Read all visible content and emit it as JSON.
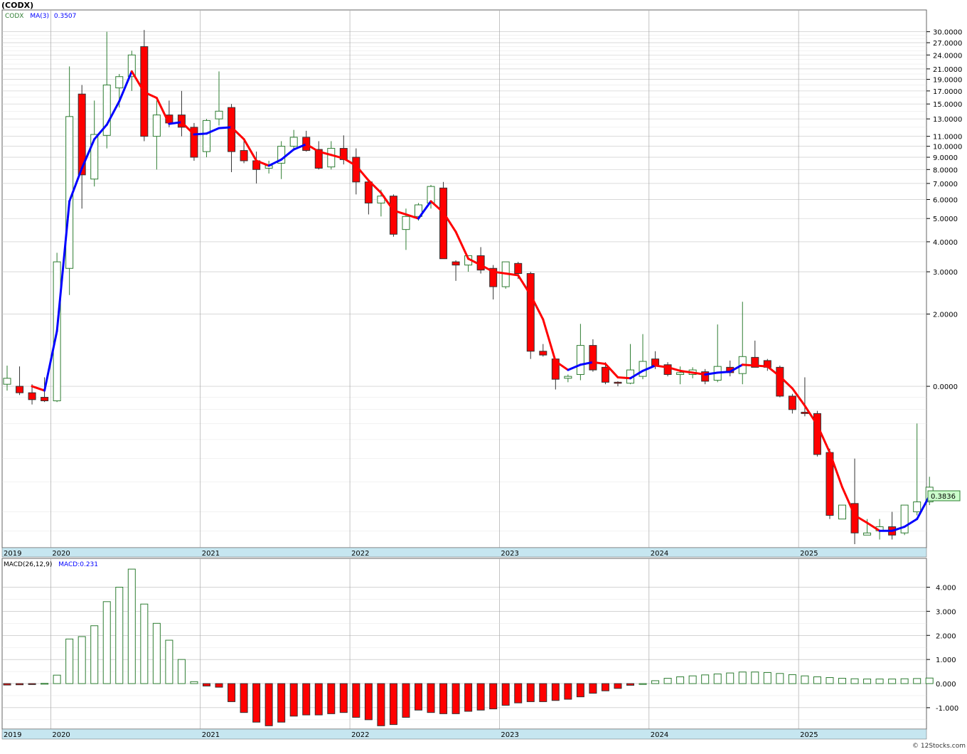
{
  "window_title": "(CODX)",
  "watermark": "© 12Stocks.com",
  "colors": {
    "up_outline": "#2e7d32",
    "down_fill": "#ff0000",
    "ma_up": "#0000ff",
    "ma_down": "#ff0000",
    "axis_band": "#c6e6f0",
    "grid": "#aaaaaa",
    "last_price_box": "#ccffcc"
  },
  "chart_data": [
    {
      "type": "candlestick",
      "id": "price",
      "legend": {
        "symbol": "CODX",
        "ma_label": "MA(3)",
        "ma_value": "0.3507"
      },
      "y_scale": "log",
      "ylim": [
        0.22,
        35
      ],
      "y_tick_labels": [
        "30.0000",
        "27.0000",
        "24.0000",
        "21.0000",
        "19.0000",
        "17.0000",
        "15.0000",
        "13.0000",
        "11.0000",
        "10.0000",
        "9.0000",
        "8.0000",
        "7.0000",
        "6.0000",
        "5.0000",
        "4.0000",
        "3.0000",
        "2.0000",
        "0.0000"
      ],
      "y_tick_values": [
        30,
        27,
        24,
        21,
        19,
        17,
        15,
        13,
        11,
        10,
        9,
        8,
        7,
        6,
        5,
        4,
        3,
        2,
        1
      ],
      "year_labels": [
        "2019",
        "2020",
        "2021",
        "2022",
        "2023",
        "2024",
        "2025"
      ],
      "year_start_index": [
        0,
        4,
        16,
        28,
        40,
        52,
        64
      ],
      "last_price_label": "0.3836",
      "candles": [
        {
          "o": 1.02,
          "h": 1.22,
          "l": 0.96,
          "c": 1.08
        },
        {
          "o": 1.0,
          "h": 1.21,
          "l": 0.92,
          "c": 0.94
        },
        {
          "o": 0.94,
          "h": 1.02,
          "l": 0.84,
          "c": 0.88
        },
        {
          "o": 0.9,
          "h": 1.09,
          "l": 0.86,
          "c": 0.87
        },
        {
          "o": 0.87,
          "h": 3.6,
          "l": 0.86,
          "c": 3.3
        },
        {
          "o": 3.1,
          "h": 21.5,
          "l": 2.4,
          "c": 13.3
        },
        {
          "o": 16.5,
          "h": 18.0,
          "l": 5.5,
          "c": 7.6
        },
        {
          "o": 7.3,
          "h": 15.5,
          "l": 6.8,
          "c": 11.2
        },
        {
          "o": 11.1,
          "h": 30.0,
          "l": 9.8,
          "c": 18.0
        },
        {
          "o": 17.5,
          "h": 20.0,
          "l": 14.5,
          "c": 19.5
        },
        {
          "o": 19.5,
          "h": 25.0,
          "l": 17.0,
          "c": 24.0
        },
        {
          "o": 26.0,
          "h": 30.5,
          "l": 10.5,
          "c": 11.0
        },
        {
          "o": 11.0,
          "h": 15.5,
          "l": 8.0,
          "c": 13.5
        },
        {
          "o": 13.5,
          "h": 15.5,
          "l": 12.0,
          "c": 12.5
        },
        {
          "o": 13.5,
          "h": 17.0,
          "l": 11.0,
          "c": 12.0
        },
        {
          "o": 12.0,
          "h": 12.5,
          "l": 8.7,
          "c": 9.0
        },
        {
          "o": 9.5,
          "h": 13.0,
          "l": 9.0,
          "c": 12.8
        },
        {
          "o": 13.0,
          "h": 20.5,
          "l": 12.2,
          "c": 14.0
        },
        {
          "o": 14.5,
          "h": 15.0,
          "l": 7.8,
          "c": 9.5
        },
        {
          "o": 9.6,
          "h": 10.5,
          "l": 8.5,
          "c": 8.7
        },
        {
          "o": 8.7,
          "h": 9.5,
          "l": 7.0,
          "c": 8.0
        },
        {
          "o": 8.1,
          "h": 8.7,
          "l": 7.7,
          "c": 8.3
        },
        {
          "o": 8.5,
          "h": 10.5,
          "l": 7.3,
          "c": 10.0
        },
        {
          "o": 10.0,
          "h": 11.7,
          "l": 9.7,
          "c": 10.9
        },
        {
          "o": 10.9,
          "h": 11.6,
          "l": 9.5,
          "c": 9.6
        },
        {
          "o": 9.7,
          "h": 10.5,
          "l": 8.0,
          "c": 8.1
        },
        {
          "o": 8.2,
          "h": 10.5,
          "l": 8.0,
          "c": 9.8
        },
        {
          "o": 9.8,
          "h": 11.1,
          "l": 8.4,
          "c": 8.8
        },
        {
          "o": 9.0,
          "h": 9.8,
          "l": 6.3,
          "c": 7.1
        },
        {
          "o": 7.1,
          "h": 7.2,
          "l": 5.2,
          "c": 5.8
        },
        {
          "o": 5.8,
          "h": 6.6,
          "l": 5.1,
          "c": 6.2
        },
        {
          "o": 6.2,
          "h": 6.3,
          "l": 4.2,
          "c": 4.3
        },
        {
          "o": 4.5,
          "h": 5.5,
          "l": 3.7,
          "c": 5.1
        },
        {
          "o": 5.1,
          "h": 5.8,
          "l": 4.9,
          "c": 5.7
        },
        {
          "o": 5.8,
          "h": 6.9,
          "l": 5.5,
          "c": 6.8
        },
        {
          "o": 6.7,
          "h": 7.1,
          "l": 3.4,
          "c": 3.4
        },
        {
          "o": 3.3,
          "h": 3.35,
          "l": 2.75,
          "c": 3.2
        },
        {
          "o": 3.2,
          "h": 3.5,
          "l": 3.0,
          "c": 3.5
        },
        {
          "o": 3.5,
          "h": 3.8,
          "l": 2.95,
          "c": 3.05
        },
        {
          "o": 3.1,
          "h": 3.2,
          "l": 2.3,
          "c": 2.6
        },
        {
          "o": 2.6,
          "h": 3.3,
          "l": 2.55,
          "c": 3.3
        },
        {
          "o": 3.25,
          "h": 3.3,
          "l": 2.8,
          "c": 2.95
        },
        {
          "o": 2.95,
          "h": 3.0,
          "l": 1.3,
          "c": 1.4
        },
        {
          "o": 1.4,
          "h": 1.5,
          "l": 1.33,
          "c": 1.35
        },
        {
          "o": 1.3,
          "h": 1.3,
          "l": 0.97,
          "c": 1.07
        },
        {
          "o": 1.08,
          "h": 1.12,
          "l": 1.04,
          "c": 1.1
        },
        {
          "o": 1.12,
          "h": 1.82,
          "l": 1.06,
          "c": 1.48
        },
        {
          "o": 1.48,
          "h": 1.57,
          "l": 1.15,
          "c": 1.17
        },
        {
          "o": 1.2,
          "h": 1.26,
          "l": 1.02,
          "c": 1.04
        },
        {
          "o": 1.04,
          "h": 1.05,
          "l": 1.0,
          "c": 1.03
        },
        {
          "o": 1.03,
          "h": 1.5,
          "l": 1.02,
          "c": 1.17
        },
        {
          "o": 1.1,
          "h": 1.65,
          "l": 1.07,
          "c": 1.27
        },
        {
          "o": 1.3,
          "h": 1.4,
          "l": 1.18,
          "c": 1.22
        },
        {
          "o": 1.23,
          "h": 1.26,
          "l": 1.1,
          "c": 1.12
        },
        {
          "o": 1.12,
          "h": 1.21,
          "l": 1.02,
          "c": 1.14
        },
        {
          "o": 1.12,
          "h": 1.2,
          "l": 1.08,
          "c": 1.17
        },
        {
          "o": 1.15,
          "h": 1.18,
          "l": 1.02,
          "c": 1.05
        },
        {
          "o": 1.06,
          "h": 1.81,
          "l": 1.04,
          "c": 1.21
        },
        {
          "o": 1.2,
          "h": 1.28,
          "l": 1.1,
          "c": 1.14
        },
        {
          "o": 1.13,
          "h": 2.25,
          "l": 1.02,
          "c": 1.33
        },
        {
          "o": 1.32,
          "h": 1.55,
          "l": 1.2,
          "c": 1.2
        },
        {
          "o": 1.28,
          "h": 1.3,
          "l": 1.16,
          "c": 1.2
        },
        {
          "o": 1.2,
          "h": 1.22,
          "l": 0.9,
          "c": 0.91
        },
        {
          "o": 0.91,
          "h": 0.93,
          "l": 0.77,
          "c": 0.8
        },
        {
          "o": 0.78,
          "h": 1.09,
          "l": 0.75,
          "c": 0.77
        },
        {
          "o": 0.77,
          "h": 0.79,
          "l": 0.51,
          "c": 0.52
        },
        {
          "o": 0.53,
          "h": 0.55,
          "l": 0.28,
          "c": 0.29
        },
        {
          "o": 0.28,
          "h": 0.32,
          "l": 0.28,
          "c": 0.32
        },
        {
          "o": 0.325,
          "h": 0.5,
          "l": 0.22,
          "c": 0.245
        },
        {
          "o": 0.24,
          "h": 0.28,
          "l": 0.24,
          "c": 0.245
        },
        {
          "o": 0.25,
          "h": 0.28,
          "l": 0.23,
          "c": 0.26
        },
        {
          "o": 0.26,
          "h": 0.3,
          "l": 0.23,
          "c": 0.24
        },
        {
          "o": 0.245,
          "h": 0.32,
          "l": 0.24,
          "c": 0.32
        },
        {
          "o": 0.3,
          "h": 0.7,
          "l": 0.29,
          "c": 0.33
        },
        {
          "o": 0.33,
          "h": 0.42,
          "l": 0.32,
          "c": 0.38
        }
      ],
      "ma": [
        null,
        null,
        1.0,
        0.96,
        1.7,
        5.9,
        8.1,
        10.7,
        12.3,
        15.4,
        20.5,
        16.8,
        15.9,
        12.4,
        12.6,
        11.2,
        11.3,
        11.9,
        12.0,
        10.7,
        8.7,
        8.3,
        8.8,
        9.7,
        10.2,
        9.5,
        9.2,
        8.9,
        8.3,
        7.2,
        6.4,
        5.4,
        5.2,
        5.0,
        5.9,
        5.3,
        4.4,
        3.4,
        3.2,
        3.0,
        2.95,
        2.9,
        2.4,
        1.9,
        1.27,
        1.17,
        1.23,
        1.26,
        1.24,
        1.09,
        1.08,
        1.16,
        1.22,
        1.2,
        1.16,
        1.14,
        1.12,
        1.14,
        1.15,
        1.23,
        1.22,
        1.21,
        1.1,
        0.98,
        0.83,
        0.69,
        0.53,
        0.38,
        0.29,
        0.27,
        0.25,
        0.25,
        0.26,
        0.28,
        0.35
      ]
    },
    {
      "type": "bar",
      "id": "macd",
      "legend": {
        "label": "MACD(26,12,9)",
        "value_label": "MACD:0.231"
      },
      "ylim": [
        -1.8,
        4.9
      ],
      "y_tick_labels": [
        "4.000",
        "3.000",
        "2.000",
        "1.000",
        "0.000",
        "-1.000"
      ],
      "y_tick_values": [
        4,
        3,
        2,
        1,
        0,
        -1
      ],
      "values": [
        -0.06,
        -0.05,
        -0.04,
        0.01,
        0.35,
        1.85,
        1.95,
        2.4,
        3.4,
        4.0,
        4.75,
        3.3,
        2.5,
        1.8,
        1.0,
        0.08,
        -0.1,
        -0.15,
        -0.75,
        -1.2,
        -1.6,
        -1.75,
        -1.6,
        -1.35,
        -1.3,
        -1.3,
        -1.25,
        -1.2,
        -1.4,
        -1.5,
        -1.75,
        -1.7,
        -1.4,
        -1.1,
        -1.2,
        -1.25,
        -1.25,
        -1.15,
        -1.1,
        -1.05,
        -0.9,
        -0.8,
        -0.75,
        -0.75,
        -0.7,
        -0.65,
        -0.55,
        -0.4,
        -0.3,
        -0.2,
        -0.07,
        0.0,
        0.12,
        0.22,
        0.28,
        0.32,
        0.36,
        0.4,
        0.44,
        0.48,
        0.48,
        0.46,
        0.42,
        0.37,
        0.32,
        0.28,
        0.25,
        0.22,
        0.2,
        0.19,
        0.19,
        0.19,
        0.2,
        0.21,
        0.23
      ]
    }
  ]
}
